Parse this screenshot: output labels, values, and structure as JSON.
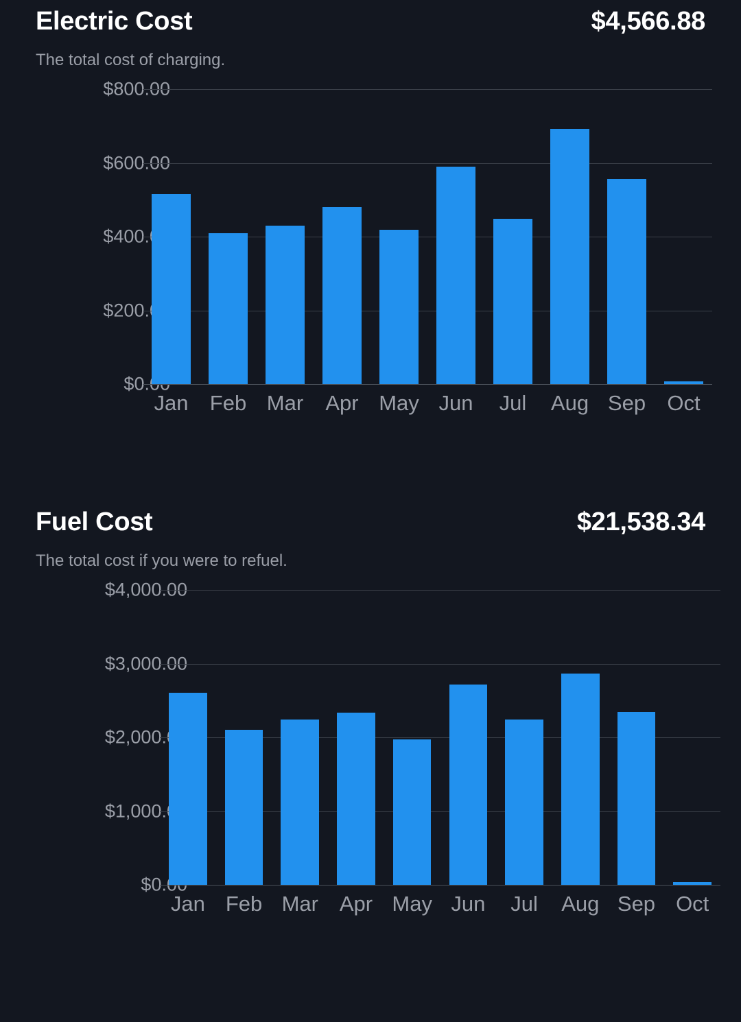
{
  "cards": [
    {
      "title": "Electric Cost",
      "total": "$4,566.88",
      "subtitle": "The total cost of charging."
    },
    {
      "title": "Fuel Cost",
      "total": "$21,538.34",
      "subtitle": "The total cost if you were to refuel."
    }
  ],
  "colors": {
    "background": "#131720",
    "bar": "#2291ee",
    "gridline": "#3b4049",
    "text_primary": "#ffffff",
    "text_secondary": "#9b9fa8"
  },
  "chart_data": [
    {
      "type": "bar",
      "title": "Electric Cost",
      "subtitle": "The total cost of charging.",
      "total": "$4,566.88",
      "xlabel": "",
      "ylabel": "",
      "ylim": [
        0,
        800
      ],
      "grid": true,
      "legend": false,
      "categories": [
        "Jan",
        "Feb",
        "Mar",
        "Apr",
        "May",
        "Jun",
        "Jul",
        "Aug",
        "Sep",
        "Oct"
      ],
      "values": [
        516,
        410,
        430,
        480,
        418,
        589,
        448,
        693,
        557,
        8
      ],
      "ytick_labels": [
        "$800.00",
        "$600.00",
        "$400.00",
        "$200.00",
        "$0.00"
      ],
      "ytick_values": [
        800,
        600,
        400,
        200,
        0
      ]
    },
    {
      "type": "bar",
      "title": "Fuel Cost",
      "subtitle": "The total cost if you were to refuel.",
      "total": "$21,538.34",
      "xlabel": "",
      "ylabel": "",
      "ylim": [
        0,
        4000
      ],
      "grid": true,
      "legend": false,
      "categories": [
        "Jan",
        "Feb",
        "Mar",
        "Apr",
        "May",
        "Jun",
        "Jul",
        "Aug",
        "Sep",
        "Oct"
      ],
      "values": [
        2608,
        2098,
        2245,
        2333,
        1971,
        2716,
        2245,
        2863,
        2343,
        40
      ],
      "ytick_labels": [
        "$4,000.00",
        "$3,000.00",
        "$2,000.00",
        "$1,000.00",
        "$0.00"
      ],
      "ytick_values": [
        4000,
        3000,
        2000,
        1000,
        0
      ]
    }
  ]
}
